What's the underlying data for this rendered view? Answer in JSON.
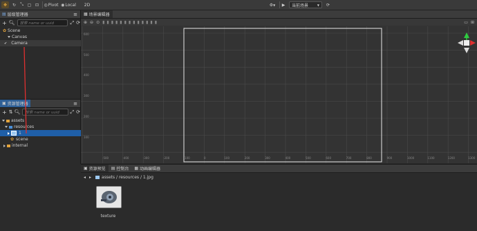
{
  "toolbar": {
    "pivot_label": "Pivot",
    "local_label": "Local",
    "mode_2d_label": "2D",
    "scene_select_label": "当前场景"
  },
  "hierarchy": {
    "title": "层级管理器",
    "search_placeholder": "搜索 name or uuid",
    "nodes": [
      "Scene",
      "Canvas",
      "Camera"
    ]
  },
  "assets": {
    "title": "资源管理器",
    "search_placeholder": "搜索 name or uuid",
    "nodes": [
      "assets",
      "resources",
      "1",
      "scene",
      "internal"
    ]
  },
  "scene_editor": {
    "tab_label": "场景编辑器",
    "y_ticks": [
      "600",
      "500",
      "400",
      "300",
      "200",
      "100"
    ],
    "x_ticks": [
      "-500",
      "-400",
      "-300",
      "-200",
      "-100",
      "0",
      "100",
      "200",
      "300",
      "400",
      "500",
      "600",
      "700",
      "800",
      "900",
      "1000",
      "1100",
      "1200",
      "1300"
    ]
  },
  "bottom": {
    "tabs": [
      "资源预览",
      "控制台",
      "动画编辑器"
    ],
    "path": "assets / resources / 1.jpg",
    "preview_label": "texture"
  },
  "colors": {
    "selection": "#1f5fa8",
    "folder": "#e4a43b",
    "annotation_red": "#e03030",
    "gizmo_green": "#2ecc40"
  }
}
